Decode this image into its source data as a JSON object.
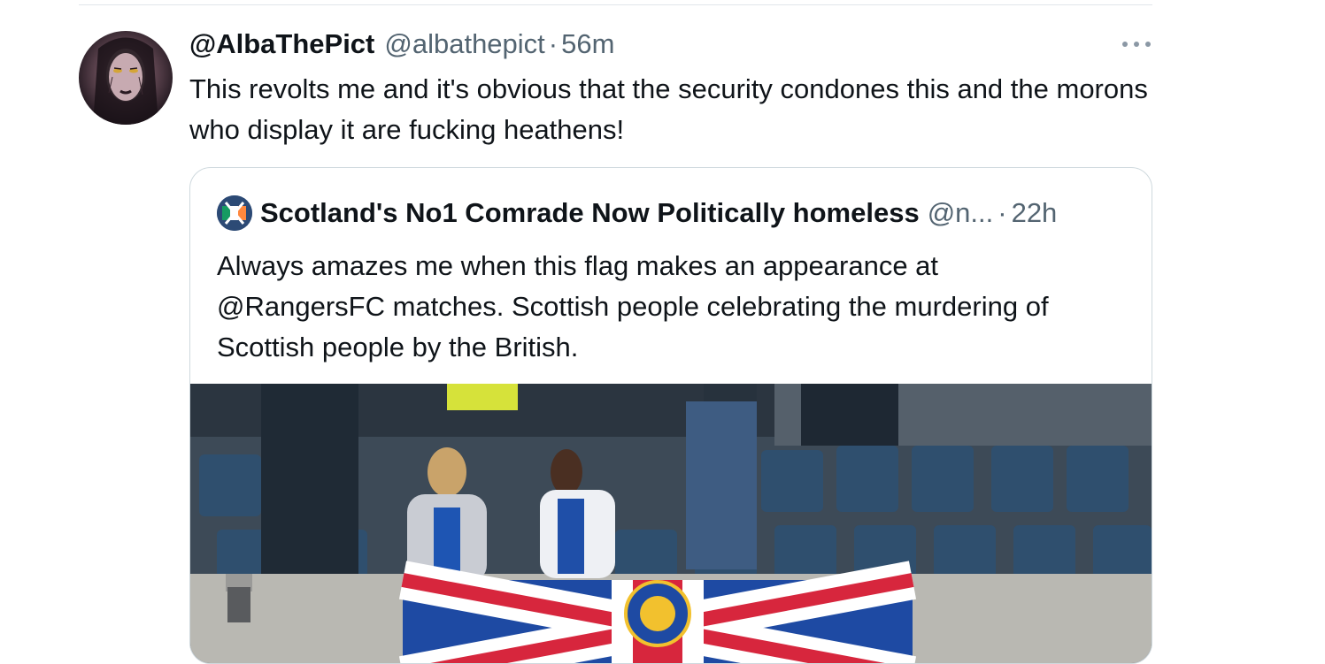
{
  "tweet": {
    "display_name": "@AlbaThePict",
    "handle": "@albathepict",
    "separator": "·",
    "time": "56m",
    "text": "This revolts me and it's obvious that the security condones this and the morons who display it are fucking heathens!",
    "more_icon": "more-horizontal-icon"
  },
  "quoted_tweet": {
    "display_name": "Scotland's No1 Comrade Now Politically homeless",
    "handle": "@n...",
    "separator": "·",
    "time": "22h",
    "text_lines": [
      "Always amazes me when this flag makes an appearance at",
      "@RangersFC matches. Scottish people celebrating the murdering of",
      "Scottish people by the British."
    ],
    "media": "photo"
  },
  "colors": {
    "text_primary": "#0f1419",
    "text_secondary": "#536471",
    "border": "#cfd9de"
  }
}
